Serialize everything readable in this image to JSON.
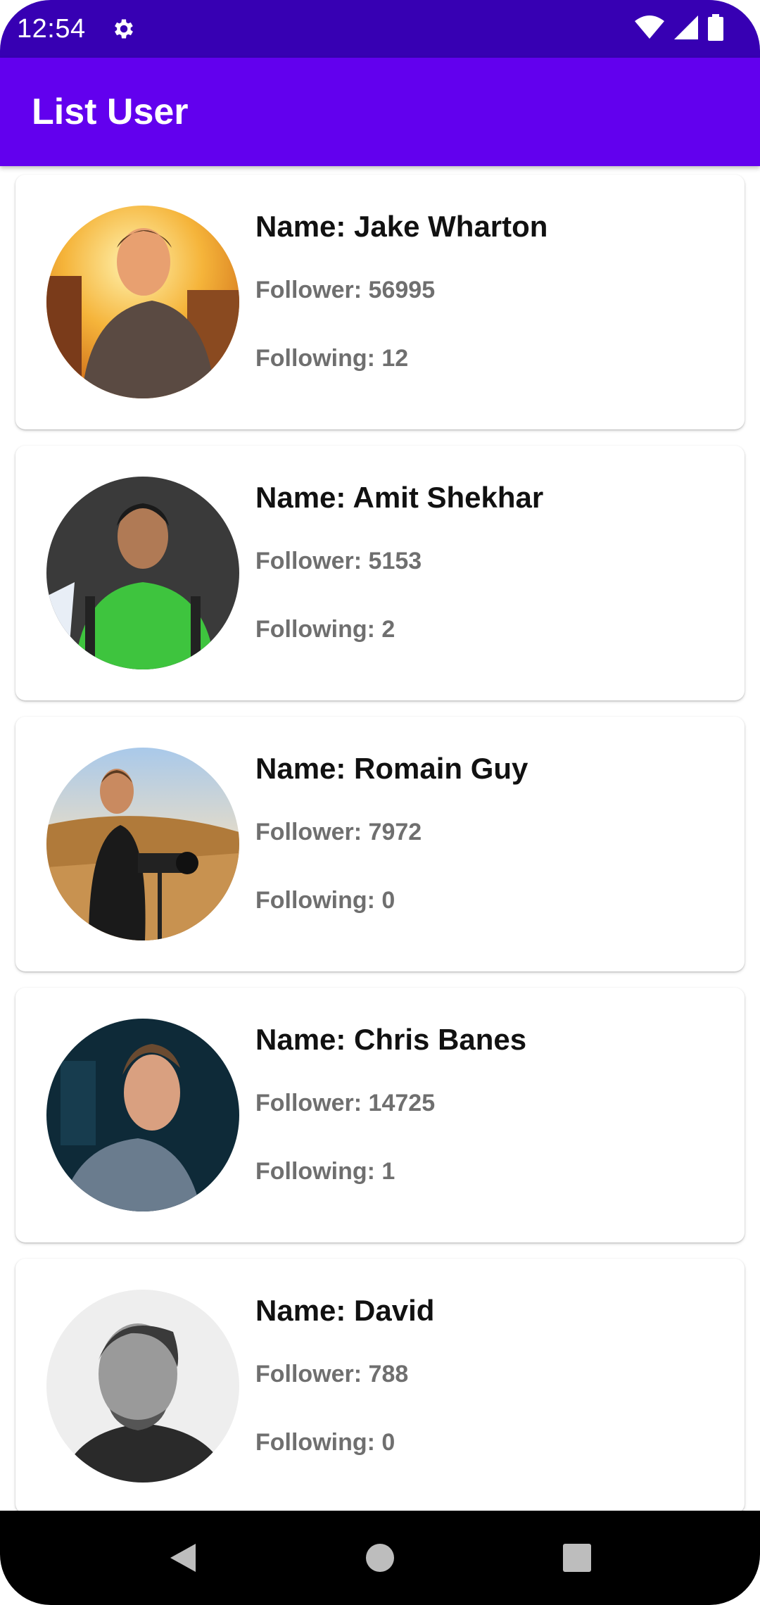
{
  "status_bar": {
    "time": "12:54",
    "icons": [
      "gear-icon",
      "wifi-icon",
      "cellular-signal-icon",
      "battery-icon"
    ],
    "background": "#3700b3"
  },
  "app_bar": {
    "title": "List User",
    "background": "#6200ee"
  },
  "users": [
    {
      "name": "Name: Jake Wharton",
      "follower": "Follower: 56995",
      "following": "Following: 12",
      "avatar": "photo-avatar"
    },
    {
      "name": "Name: Amit Shekhar",
      "follower": "Follower: 5153",
      "following": "Following: 2",
      "avatar": "photo-avatar"
    },
    {
      "name": "Name: Romain Guy",
      "follower": "Follower: 7972",
      "following": "Following: 0",
      "avatar": "photo-avatar"
    },
    {
      "name": "Name: Chris Banes",
      "follower": "Follower: 14725",
      "following": "Following: 1",
      "avatar": "photo-avatar"
    },
    {
      "name": "Name: David",
      "follower": "Follower: 788",
      "following": "Following: 0",
      "avatar": "photo-avatar"
    }
  ],
  "nav_bar": {
    "buttons": [
      "back-triangle-icon",
      "home-circle-icon",
      "recents-square-icon"
    ]
  },
  "colors": {
    "name_text": "#111111",
    "secondary_text": "#6f6f6f"
  }
}
